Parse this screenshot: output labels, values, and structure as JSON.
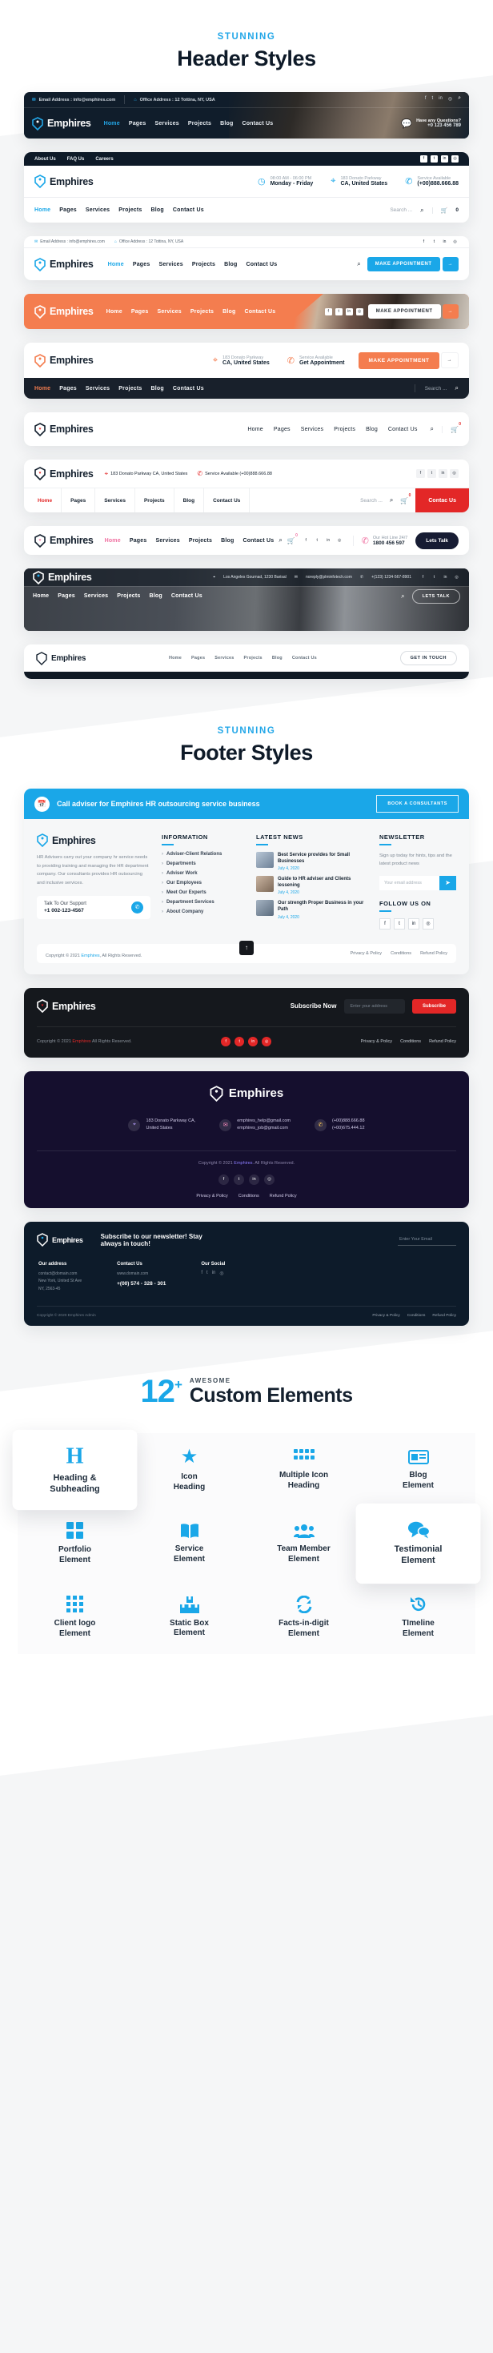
{
  "sections": {
    "headers": {
      "kicker": "STUNNING",
      "title": "Header Styles"
    },
    "footers": {
      "kicker": "STUNNING",
      "title": "Footer Styles"
    },
    "elements": {
      "count": "12",
      "plus": "+",
      "kicker": "AWESOME",
      "title": "Custom Elements"
    }
  },
  "brand": {
    "name": "Emphires",
    "accent_blue": "#1aa7e8",
    "accent_orange": "#f47d4f",
    "accent_red": "#e32727",
    "accent_pink": "#f06fa0"
  },
  "common": {
    "nav": [
      "Home",
      "Pages",
      "Services",
      "Projects",
      "Blog",
      "Contact Us"
    ],
    "search_placeholder": "Search ...",
    "email_label": "Email Address : info@emphires.com",
    "office_label": "Office Address : 12 Tottina, NY, USA",
    "social": [
      "facebook-icon",
      "twitter-icon",
      "linkedin-icon",
      "instagram-icon"
    ]
  },
  "header1": {
    "email": "Email Address : info@emphires.com",
    "office": "Office Address : 12 Tottina, NY, USA",
    "questions_label": "Have any Questions?",
    "questions_phone": "+0 123 456 789",
    "search_icon": "search-icon"
  },
  "header2": {
    "toplinks": [
      "About Us",
      "FAQ Us",
      "Careers"
    ],
    "info": [
      {
        "icon": "clock-icon",
        "top": "08:00 AM - 06:00 PM",
        "bottom": "Monday - Friday"
      },
      {
        "icon": "location-icon",
        "top": "183 Donato Parkway",
        "bottom": "CA, United States"
      },
      {
        "icon": "phone-icon",
        "top": "Service Available",
        "bottom": "(+00)888.666.88"
      }
    ],
    "cart_count": "0"
  },
  "header3": {
    "cta": "MAKE APPOINTMENT"
  },
  "header4": {
    "cta": "MAKE APPOINTMENT"
  },
  "header5": {
    "info": [
      {
        "icon": "location-icon",
        "top": "183 Donato Parkway",
        "bottom": "CA, United States"
      },
      {
        "icon": "phone-icon",
        "top": "Service Available",
        "bottom": "Get Appointment"
      }
    ],
    "cta": "MAKE APPOINTMENT"
  },
  "header6": {
    "cart_count": "0"
  },
  "header7": {
    "address": "183 Donato Parkway CA, United States",
    "service": "Service Available (+00)888.666.88",
    "cta": "Contac Us",
    "cart_count": "0"
  },
  "header8": {
    "hotline_label": "Our Hot Line 24/7",
    "hotline_num": "1800 456 597",
    "cta": "Lets Talk",
    "cart_count": "0"
  },
  "header9": {
    "address": "Los Angeles Gournad, 1230 Barisal",
    "email": "noreply@plminfotech.com",
    "phone": "+(123) 1234-567-8901",
    "cta": "LETS TALK"
  },
  "header10": {
    "cta": "GET IN TOUCH"
  },
  "footer1": {
    "cta_text": "Call adviser for Emphires HR outsourcing service business",
    "cta_button": "BOOK A CONSULTANTS",
    "about": "HR Advisers carry out your company hr service needs to providing training and managing the HR department company. Our consultants provides HR outsourcing and inclusive services.",
    "support_label": "Talk To Our Support",
    "support_phone": "+1 002-123-4567",
    "info_title": "INFORMATION",
    "info_links": [
      "Adviser-Client Relations",
      "Departments",
      "Adviser Work",
      "Our Employees",
      "Meet Our Experts",
      "Department Services",
      "About Company"
    ],
    "news_title": "LATEST NEWS",
    "news": [
      {
        "title": "Best Service provides for Small Businesses",
        "date": "July 4, 2020"
      },
      {
        "title": "Guide to HR adviser and Clients lessening",
        "date": "July 4, 2020"
      },
      {
        "title": "Our strength Proper Business in your Path",
        "date": "July 4, 2020"
      }
    ],
    "newsletter_title": "NEWSLETTER",
    "newsletter_text": "Sign up today for hints, tips and the latest product news",
    "newsletter_placeholder": "Your email address",
    "follow_title": "FOLLOW US ON",
    "copyright_pre": "Copyright © 2021 ",
    "copyright_brand": "Emphires",
    "copyright_post": ", All Rights Reserved.",
    "bottom_links": [
      "Privacy & Policy",
      "Conditions",
      "Refund Policy"
    ],
    "scroll_top_icon": "arrow-up-icon"
  },
  "footer2": {
    "subscribe_label": "Subscribe Now",
    "placeholder": "Enter your address",
    "button": "Subscribe",
    "copyright_pre": "Copyright © 2021 ",
    "copyright_brand": "Emphires",
    "copyright_post": " All Rights Reserved.",
    "bottom_links": [
      "Privacy & Policy",
      "Conditions",
      "Refund Policy"
    ]
  },
  "footer3": {
    "contacts": [
      {
        "icon": "location-icon",
        "l1": "183 Donato Parkway CA,",
        "l2": "United States"
      },
      {
        "icon": "mail-icon",
        "l1": "emphires_help@gmail.com",
        "l2": "emphires_job@gmail.com"
      },
      {
        "icon": "phone-icon",
        "l1": "(+00)888.666.88",
        "l2": "(+00)675.444.12"
      }
    ],
    "copyright_pre": "Copyright © 2021 ",
    "copyright_brand": "Emphires",
    "copyright_post": ". All Rights Reserved.",
    "bottom_links": [
      "Privacy & Policy",
      "Conditions",
      "Refund Policy"
    ]
  },
  "footer4": {
    "headline_l1": "Subscribe to our newsletter! Stay",
    "headline_l2": "always in touch!",
    "placeholder": "Enter Your Email",
    "cols": [
      {
        "title": "Our address",
        "l1": "contact@domain.com",
        "l2": "New York, United St Ave",
        "l3": "NY, 2563-45"
      },
      {
        "title": "Contact Us",
        "l1": "www.domain.com",
        "l2": "+(00) 574 - 328 - 301",
        "l3": ""
      },
      {
        "title": "Our Social",
        "l1": "",
        "l2": "",
        "l3": ""
      }
    ],
    "copyright": "Copyright © 2020 Emphires Admin",
    "bottom_links": [
      "Privacy & Policy",
      "Conditions",
      "Refund Policy"
    ]
  },
  "elements": [
    {
      "icon": "heading-icon",
      "glyph": "H",
      "label": "Heading &\nSubheading",
      "popped": true
    },
    {
      "icon": "star-icon",
      "glyph": "★",
      "label": "Icon\nHeading",
      "popped": false
    },
    {
      "icon": "multi-icon",
      "glyph": "▦",
      "label": "Multiple Icon\nHeading",
      "popped": false
    },
    {
      "icon": "blog-icon",
      "glyph": "▤",
      "label": "Blog\nElement",
      "popped": false
    },
    {
      "icon": "portfolio-icon",
      "glyph": "◪",
      "label": "Portfolio\nElement",
      "popped": false
    },
    {
      "icon": "book-icon",
      "glyph": "▤",
      "label": "Service\nElement",
      "popped": false
    },
    {
      "icon": "team-icon",
      "glyph": "▣",
      "label": "Team Member\nElement",
      "popped": false
    },
    {
      "icon": "testimonial-icon",
      "glyph": "◍",
      "label": "Testimonial\nElement",
      "popped": true
    },
    {
      "icon": "client-logo-icon",
      "glyph": "▦",
      "label": "Client logo\nElement",
      "popped": false
    },
    {
      "icon": "static-box-icon",
      "glyph": "▥",
      "label": "Static Box\nElement",
      "popped": false
    },
    {
      "icon": "facts-icon",
      "glyph": "⟳",
      "label": "Facts-in-digit\nElement",
      "popped": false
    },
    {
      "icon": "timeline-icon",
      "glyph": "↺",
      "label": "TImeline\nElement",
      "popped": false
    }
  ]
}
